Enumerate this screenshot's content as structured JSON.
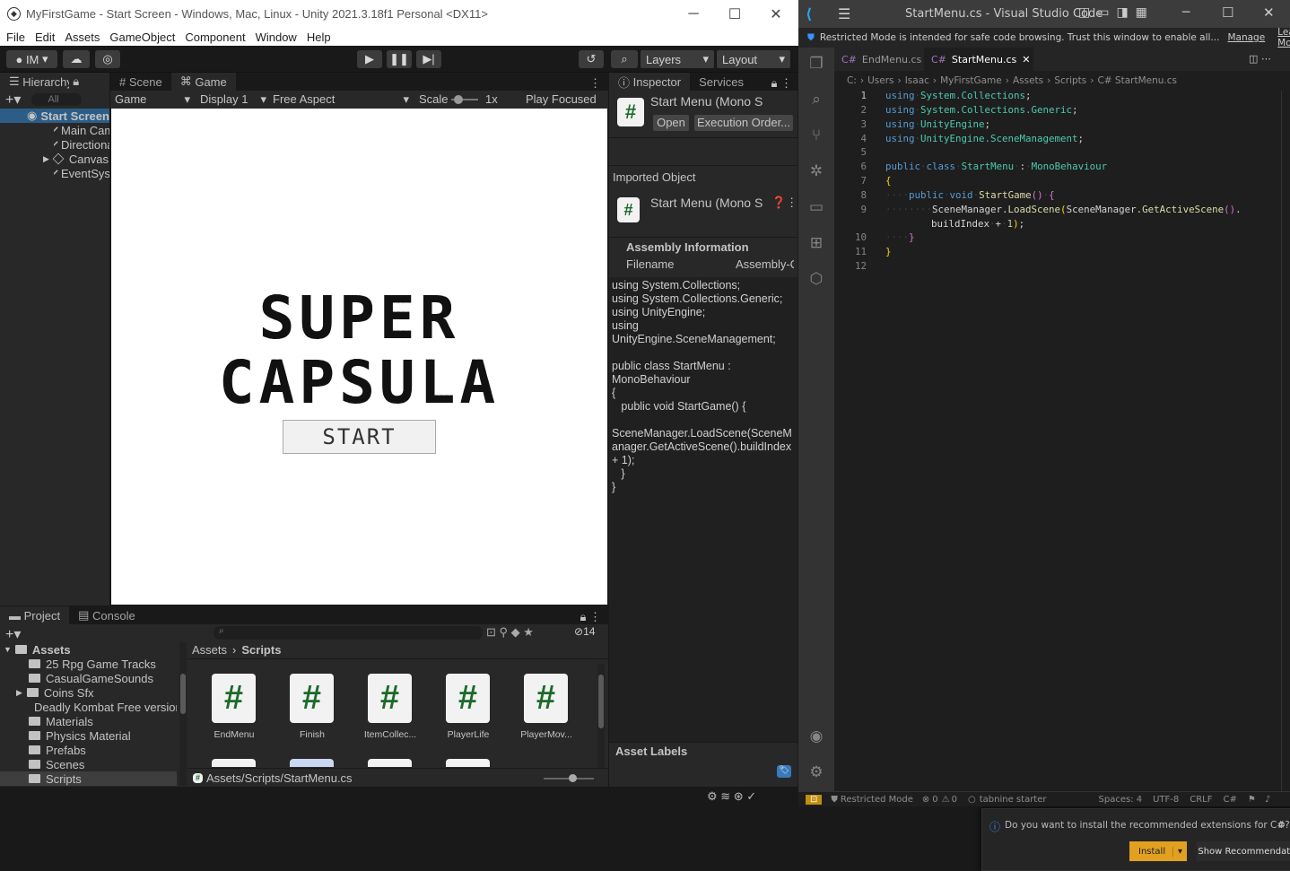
{
  "unity": {
    "title": "MyFirstGame - Start Screen - Windows, Mac, Linux - Unity 2021.3.18f1 Personal <DX11>",
    "menu": [
      "File",
      "Edit",
      "Assets",
      "GameObject",
      "Component",
      "Window",
      "Help"
    ],
    "account": "IM",
    "layers": "Layers",
    "layout": "Layout",
    "hierarchy": {
      "tab": "Hierarchy",
      "search_placeholder": "All",
      "scene": "Start Screen",
      "items": [
        "Main Camera",
        "Directional Light",
        "Canvas",
        "EventSystem"
      ]
    },
    "scene_tabs": [
      "Scene",
      "Game"
    ],
    "game_bar": {
      "view": "Game",
      "display": "Display 1",
      "aspect": "Free Aspect",
      "scale_label": "Scale",
      "scale_value": "1x",
      "play_mode": "Play Focused"
    },
    "game": {
      "title_line1": "SUPER",
      "title_line2": "CAPSULA",
      "start_button": "START"
    },
    "inspector": {
      "tabs": [
        "Inspector",
        "Services"
      ],
      "script_name": "Start Menu (Mono S",
      "open": "Open",
      "exec_order": "Execution Order...",
      "imported_object": "Imported Object",
      "imported_name": "Start Menu (Mono S",
      "assembly_info": "Assembly Information",
      "filename_label": "Filename",
      "filename_value": "Assembly-C",
      "code": "using System.Collections;\nusing System.Collections.Generic;\nusing UnityEngine;\nusing\nUnityEngine.SceneManagement;\n\npublic class StartMenu :\nMonoBehaviour\n{\n   public void StartGame() {\n\nSceneManager.LoadScene(SceneM\nanager.GetActiveScene().buildIndex\n+ 1);\n   }\n}",
      "asset_labels": "Asset Labels"
    },
    "project": {
      "tabs": [
        "Project",
        "Console"
      ],
      "hidden_count": "14",
      "tree_root": "Assets",
      "folders": [
        "25 Rpg Game Tracks",
        "CasualGameSounds",
        "Coins Sfx",
        "Deadly Kombat Free version",
        "Materials",
        "Physics Material",
        "Prefabs",
        "Scenes",
        "Scripts"
      ],
      "breadcrumb": [
        "Assets",
        "Scripts"
      ],
      "files": [
        "EndMenu",
        "Finish",
        "ItemCollec...",
        "PlayerLife",
        "PlayerMov..."
      ],
      "path": "Assets/Scripts/StartMenu.cs"
    }
  },
  "vscode": {
    "title": "StartMenu.cs - Visual Studio Code",
    "restricted_msg": "Restricted Mode is intended for safe code browsing. Trust this window to enable all...",
    "manage": "Manage",
    "learn_more": "Learn More",
    "tabs": [
      "EndMenu.cs",
      "StartMenu.cs"
    ],
    "tab_prefix": "C#",
    "breadcrumb": [
      "C:",
      "Users",
      "Isaac",
      "MyFirstGame",
      "Assets",
      "Scripts",
      "C# StartMenu.cs"
    ],
    "notification": "Do you want to install the recommended extensions for C#?",
    "install": "Install",
    "show_recs": "Show Recommendations",
    "status": {
      "mode": "Restricted Mode",
      "problems": "0",
      "warnings": "0",
      "tabnine": "tabnine starter",
      "spaces": "Spaces: 4",
      "encoding": "UTF-8",
      "eol": "CRLF",
      "lang": "C#"
    }
  }
}
